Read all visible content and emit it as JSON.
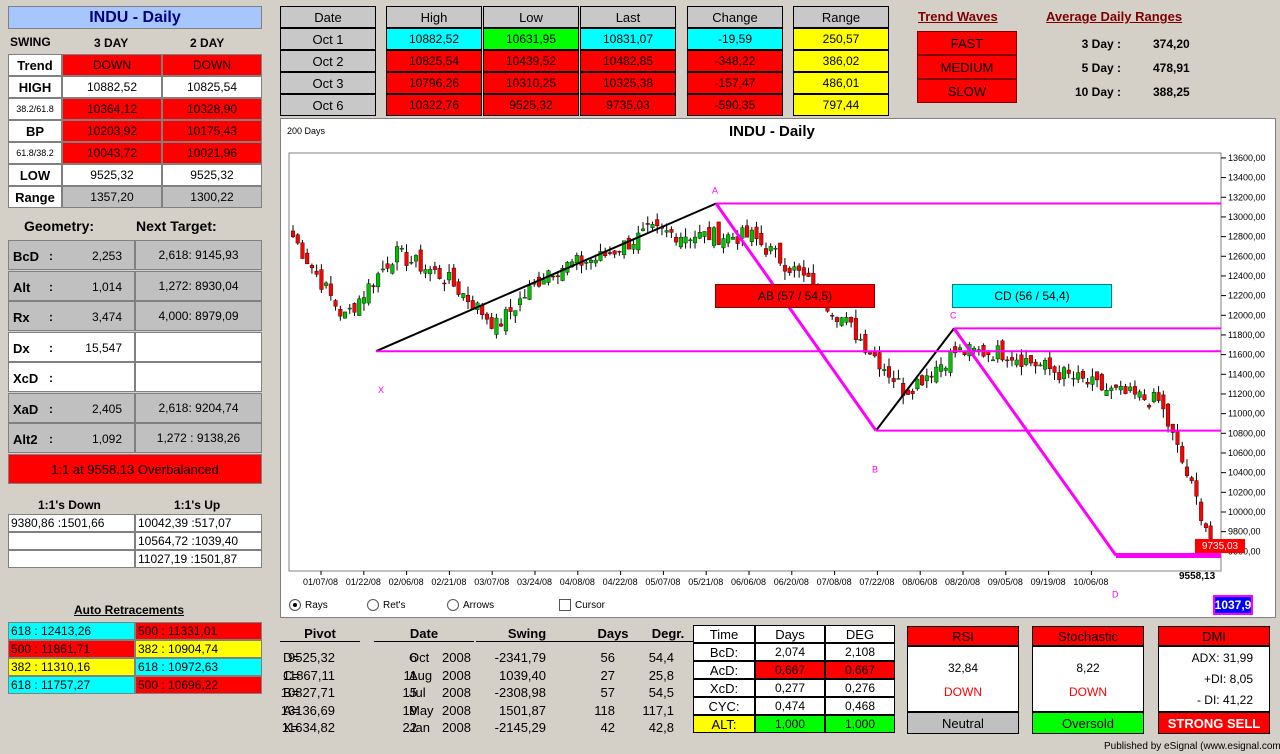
{
  "indu": {
    "title": "INDU - Daily",
    "swing": "SWING",
    "c3": "3 DAY",
    "c2": "2 DAY",
    "rows": [
      {
        "l": "Trend",
        "a": "DOWN",
        "b": "DOWN",
        "ca": "red",
        "cb": "red"
      },
      {
        "l": "HIGH",
        "a": "10882,52",
        "b": "10825,54",
        "ca": "wht",
        "cb": "wht"
      },
      {
        "l": "38.2/61.8",
        "a": "10364,12",
        "b": "10328,90",
        "ca": "red",
        "cb": "red",
        "small": true
      },
      {
        "l": "BP",
        "a": "10203,92",
        "b": "10175,43",
        "ca": "red",
        "cb": "red"
      },
      {
        "l": "61.8/38.2",
        "a": "10043,72",
        "b": "10021,96",
        "ca": "red",
        "cb": "red",
        "small": true
      },
      {
        "l": "LOW",
        "a": "9525,32",
        "b": "9525,32",
        "ca": "wht",
        "cb": "wht"
      },
      {
        "l": "Range",
        "a": "1357,20",
        "b": "1300,22",
        "ca": "gry",
        "cb": "gry"
      }
    ]
  },
  "geometry": {
    "title": "Geometry:",
    "next": "Next Target:",
    "rows": [
      {
        "l": "BcD",
        "v": "2,253",
        "t": "2,618: 9145,93"
      },
      {
        "l": "Alt",
        "v": "1,014",
        "t": "1,272: 8930,04"
      },
      {
        "l": "Rx",
        "v": "3,474",
        "t": "4,000: 8979,09"
      },
      {
        "l": "Dx",
        "v": "15,547",
        "t": ""
      },
      {
        "l": "XcD",
        "v": "",
        "t": ""
      },
      {
        "l": "XaD",
        "v": "2,405",
        "t": "2,618: 9204,74"
      },
      {
        "l": "Alt2",
        "v": "1,092",
        "t": "1,272 : 9138,26"
      }
    ],
    "balance": "1:1 at 9558,13 Overbalanced"
  },
  "ones": {
    "down": "1:1's Down",
    "up": "1:1's Up",
    "downs": [
      "9380,86 :1501,66",
      "",
      ""
    ],
    "ups": [
      "10042,39 :517,07",
      "10564,72 :1039,40",
      "11027,19 :1501,87"
    ]
  },
  "retr": {
    "title": "Auto Retracements",
    "rows": [
      {
        "a": "618 : 12413,26",
        "ca": "cya",
        "b": "500 : 11331,01",
        "cb": "red"
      },
      {
        "a": "500 : 11861,71",
        "ca": "red",
        "b": "382 : 10904,74",
        "cb": "yel"
      },
      {
        "a": "382 : 11310,16",
        "ca": "yel",
        "b": "618 : 10972,63",
        "cb": "cya"
      },
      {
        "a": "618 : 11757,27",
        "ca": "cya",
        "b": "500 : 10696,22",
        "cb": "red"
      }
    ]
  },
  "quotes": {
    "h": [
      "Date",
      "High",
      "Low",
      "Last",
      "Change",
      "Range"
    ],
    "rows": [
      {
        "d": "Oct  1",
        "h": "10882,52",
        "l": "10631,95",
        "la": "10831,07",
        "c": "-19,59",
        "r": "250,57",
        "ch": "cya",
        "cl": "grn",
        "cla": "cya",
        "cc": "cya"
      },
      {
        "d": "Oct  2",
        "h": "10825,54",
        "l": "10439,52",
        "la": "10482,85",
        "c": "-348,22",
        "r": "386,02",
        "ch": "red",
        "cl": "red",
        "cla": "red",
        "cc": "red"
      },
      {
        "d": "Oct  3",
        "h": "10796,26",
        "l": "10310,25",
        "la": "10325,38",
        "c": "-157,47",
        "r": "486,01",
        "ch": "red",
        "cl": "red",
        "cla": "red",
        "cc": "red"
      },
      {
        "d": "Oct  6",
        "h": "10322,76",
        "l": "9525,32",
        "la": "9735,03",
        "c": "-590,35",
        "r": "797,44",
        "ch": "red",
        "cl": "red",
        "cla": "red",
        "cc": "red"
      }
    ]
  },
  "waves": {
    "title": "Trend Waves",
    "items": [
      "FAST",
      "MEDIUM",
      "SLOW"
    ]
  },
  "adr": {
    "title": "Average Daily Ranges",
    "rows": [
      {
        "l": "3 Day :",
        "v": "374,20"
      },
      {
        "l": "5 Day :",
        "v": "478,91"
      },
      {
        "l": "10 Day :",
        "v": "388,25"
      }
    ]
  },
  "chart": {
    "days": "200 Days",
    "title": "INDU - Daily",
    "ab": "AB (57 / 54,5)",
    "cd": "CD (56 / 54,4)",
    "last": "9735,03",
    "low": "9558,13",
    "counter": "1037,9",
    "radios": [
      "Rays",
      "Ret's",
      "Arrows"
    ],
    "cursor": "Cursor",
    "dates": [
      "01/07/08",
      "01/22/08",
      "02/06/08",
      "02/21/08",
      "03/07/08",
      "03/24/08",
      "04/08/08",
      "04/22/08",
      "05/07/08",
      "05/21/08",
      "06/06/08",
      "06/20/08",
      "07/08/08",
      "07/22/08",
      "08/06/08",
      "08/20/08",
      "09/05/08",
      "09/19/08",
      "10/06/08"
    ],
    "prices": [
      "13600,00",
      "13400,00",
      "13200,00",
      "13000,00",
      "12800,00",
      "12600,00",
      "12400,00",
      "12200,00",
      "12000,00",
      "11800,00",
      "11600,00",
      "11400,00",
      "11200,00",
      "11000,00",
      "10800,00",
      "10600,00",
      "10400,00",
      "10200,00",
      "10000,00",
      "9800,00",
      "9600,00"
    ],
    "points": [
      "A",
      "B",
      "C",
      "D",
      "X"
    ]
  },
  "chart_data": {
    "type": "candlestick",
    "title": "INDU - Daily",
    "ylim": [
      9400,
      13650
    ],
    "x": [
      "01/07/08",
      "01/22/08",
      "02/06/08",
      "02/21/08",
      "03/07/08",
      "03/24/08",
      "04/08/08",
      "04/22/08",
      "05/07/08",
      "05/21/08",
      "06/06/08",
      "06/20/08",
      "07/08/08",
      "07/22/08",
      "08/06/08",
      "08/20/08",
      "09/05/08",
      "09/19/08",
      "10/06/08"
    ],
    "close": [
      12800,
      11970,
      12630,
      12380,
      11890,
      12460,
      12580,
      12850,
      12810,
      12800,
      12390,
      11840,
      11230,
      11630,
      11620,
      11420,
      11230,
      11120,
      9735
    ],
    "levels": [
      13136.69,
      11634.82,
      10827.71,
      11867.11,
      9558.13
    ]
  },
  "pivots": {
    "h": [
      "Pivot",
      "Date",
      "Swing",
      "Days",
      "Degr."
    ],
    "rows": [
      {
        "p": "D=",
        "v": "9525,32",
        "d": "6",
        "m": "Oct",
        "y": "2008",
        "s": "-2341,79",
        "n": "56",
        "g": "54,4"
      },
      {
        "p": "C=",
        "v": "11867,11",
        "d": "11",
        "m": "Aug",
        "y": "2008",
        "s": "1039,40",
        "n": "27",
        "g": "25,8"
      },
      {
        "p": "B=",
        "v": "10827,71",
        "d": "15",
        "m": "Jul",
        "y": "2008",
        "s": "-2308,98",
        "n": "57",
        "g": "54,5"
      },
      {
        "p": "A=",
        "v": "13136,69",
        "d": "19",
        "m": "May",
        "y": "2008",
        "s": "1501,87",
        "n": "118",
        "g": "117,1"
      },
      {
        "p": "X=",
        "v": "11634,82",
        "d": "22",
        "m": "Jan",
        "y": "2008",
        "s": "-2145,29",
        "n": "42",
        "g": "42,8"
      }
    ]
  },
  "time": {
    "h": [
      "Time",
      "Days",
      "DEG"
    ],
    "rows": [
      {
        "l": "BcD:",
        "a": "2,074",
        "b": "2,108",
        "c": "wht"
      },
      {
        "l": "AcD:",
        "a": "0,667",
        "b": "0,667",
        "c": "red"
      },
      {
        "l": "XcD:",
        "a": "0,277",
        "b": "0,276",
        "c": "wht"
      },
      {
        "l": "CYC:",
        "a": "0,474",
        "b": "0,468",
        "c": "wht"
      },
      {
        "l": "ALT:",
        "a": "1,000",
        "b": "1,000",
        "c": "grn"
      }
    ]
  },
  "rsi": {
    "t": "RSI",
    "v": "32,84",
    "s": "DOWN",
    "f": "Neutral"
  },
  "stoch": {
    "t": "Stochastic",
    "v": "8,22",
    "s": "DOWN",
    "f": "Oversold"
  },
  "dmi": {
    "t": "DMI",
    "adx": "ADX:  31,99",
    "pdi": "+DI:  8,05",
    "mdi": "- DI:  41,22",
    "f": "STRONG SELL"
  },
  "footer": "Published by eSignal (www.esignal.com)"
}
